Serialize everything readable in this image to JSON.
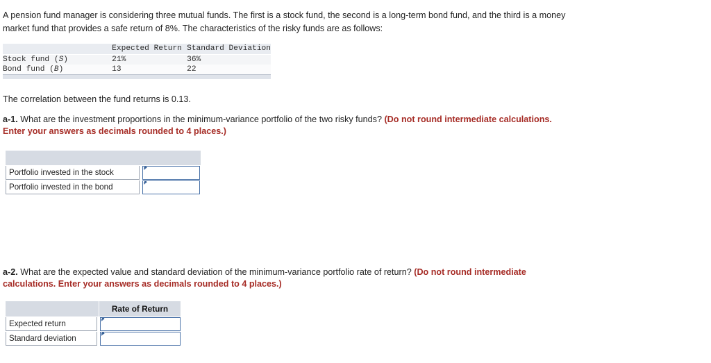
{
  "intro": {
    "paragraph": "A pension fund manager is considering three mutual funds. The first is a stock fund, the second is a long-term bond fund, and the third is a money market fund that provides a safe return of 8%. The characteristics of the risky funds are as follows:"
  },
  "fund_table": {
    "headers": [
      "",
      "Expected Return",
      "Standard Deviation"
    ],
    "rows": [
      {
        "label_prefix": "Stock fund (",
        "label_symbol": "S",
        "label_suffix": ")",
        "expected_return": "21%",
        "standard_deviation": "36%"
      },
      {
        "label_prefix": "Bond fund (",
        "label_symbol": "B",
        "label_suffix": ")",
        "expected_return": "13",
        "standard_deviation": "22"
      }
    ]
  },
  "correlation_line": "The correlation between the fund returns is 0.13.",
  "question_a1": {
    "tag": "a-1.",
    "text": " What are the investment proportions in the minimum-variance portfolio of the two risky funds? ",
    "instruction": "(Do not round intermediate calculations. Enter your answers as decimals rounded to 4 places.)"
  },
  "answer_table_a1": {
    "header_label": "",
    "header_value": "",
    "rows": [
      {
        "label": "Portfolio invested in the stock",
        "value": ""
      },
      {
        "label": "Portfolio invested in the bond",
        "value": ""
      }
    ]
  },
  "question_a2": {
    "tag": "a-2.",
    "text": " What are the expected value and standard deviation of the minimum-variance portfolio rate of return? ",
    "instruction": "(Do not round intermediate calculations. Enter your answers as decimals rounded to 4 places.)"
  },
  "answer_table_a2": {
    "header_label": "",
    "header_value": "Rate of Return",
    "rows": [
      {
        "label": "Expected return",
        "value": ""
      },
      {
        "label": "Standard deviation",
        "value": ""
      }
    ]
  },
  "colors": {
    "instruction_red": "#a62c26",
    "entry_border_blue": "#4a72a8",
    "table_header_gray": "#d6dbe3",
    "fund_header_gray": "#e9ecf1"
  }
}
